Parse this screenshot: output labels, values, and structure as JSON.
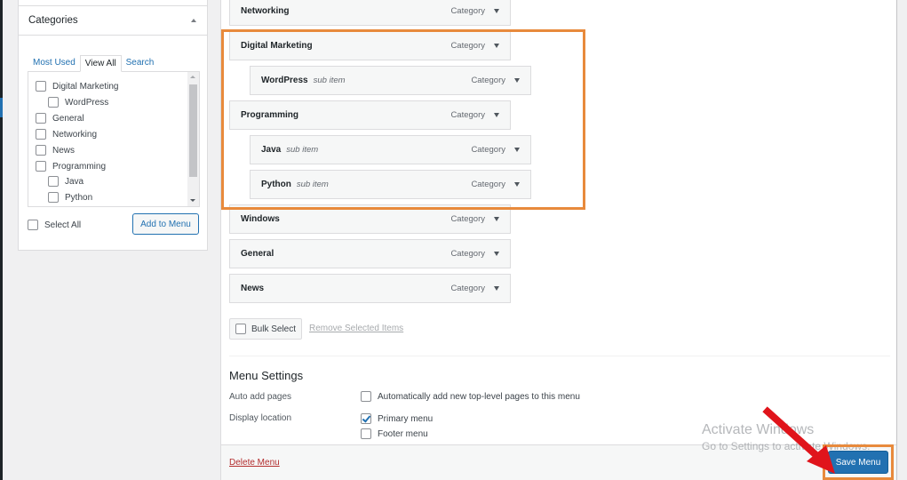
{
  "categories_box": {
    "title": "Categories",
    "tabs": [
      {
        "label": "Most Used",
        "active": false
      },
      {
        "label": "View All",
        "active": true
      },
      {
        "label": "Search",
        "active": false
      }
    ],
    "items": [
      {
        "label": "Digital Marketing",
        "level": 0,
        "checked": false
      },
      {
        "label": "WordPress",
        "level": 1,
        "checked": false
      },
      {
        "label": "General",
        "level": 0,
        "checked": false
      },
      {
        "label": "Networking",
        "level": 0,
        "checked": false
      },
      {
        "label": "News",
        "level": 0,
        "checked": false
      },
      {
        "label": "Programming",
        "level": 0,
        "checked": false
      },
      {
        "label": "Java",
        "level": 1,
        "checked": false
      },
      {
        "label": "Python",
        "level": 1,
        "checked": false
      }
    ],
    "select_all_label": "Select All",
    "add_button_label": "Add to Menu"
  },
  "menu_structure": {
    "items": [
      {
        "title": "Networking",
        "sub_label": "",
        "type": "Category",
        "level": 0
      },
      {
        "title": "Digital Marketing",
        "sub_label": "",
        "type": "Category",
        "level": 0
      },
      {
        "title": "WordPress",
        "sub_label": "sub item",
        "type": "Category",
        "level": 1
      },
      {
        "title": "Programming",
        "sub_label": "",
        "type": "Category",
        "level": 0
      },
      {
        "title": "Java",
        "sub_label": "sub item",
        "type": "Category",
        "level": 1
      },
      {
        "title": "Python",
        "sub_label": "sub item",
        "type": "Category",
        "level": 1
      },
      {
        "title": "Windows",
        "sub_label": "",
        "type": "Category",
        "level": 0
      },
      {
        "title": "General",
        "sub_label": "",
        "type": "Category",
        "level": 0
      },
      {
        "title": "News",
        "sub_label": "",
        "type": "Category",
        "level": 0
      }
    ],
    "bulk_select_label": "Bulk Select",
    "remove_selected_label": "Remove Selected Items"
  },
  "menu_settings": {
    "title": "Menu Settings",
    "auto_add_label": "Auto add pages",
    "auto_add_option": {
      "label": "Automatically add new top-level pages to this menu",
      "checked": false
    },
    "display_location_label": "Display location",
    "locations": [
      {
        "label": "Primary menu",
        "checked": true
      },
      {
        "label": "Footer menu",
        "checked": false
      }
    ]
  },
  "footer": {
    "delete_label": "Delete Menu",
    "save_label": "Save Menu"
  },
  "watermark": {
    "line1": "Activate Windows",
    "line2": "Go to Settings to activate Windows."
  },
  "annotation_color": "#e88a3c",
  "arrow_color": "#e0141b",
  "accent_color": "#2271b1"
}
